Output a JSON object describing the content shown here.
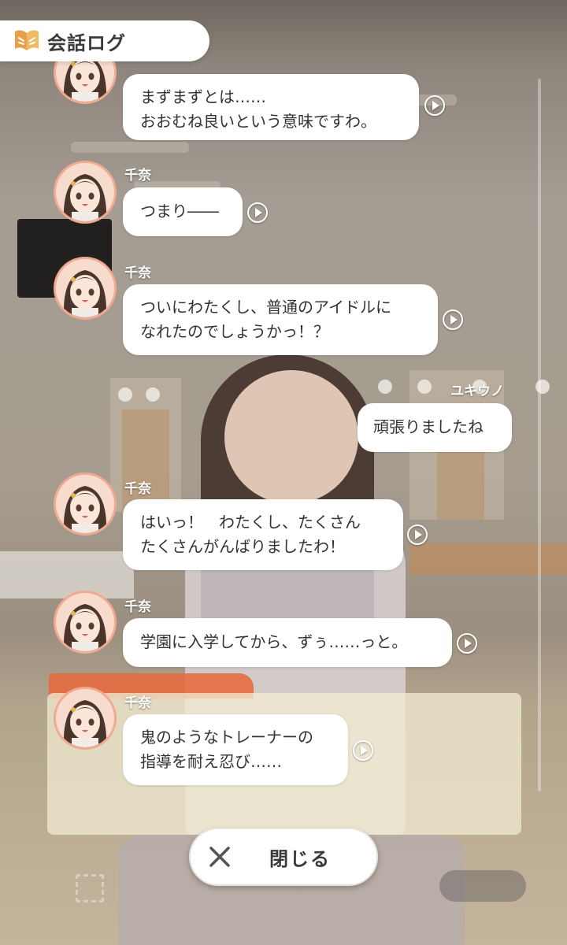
{
  "header": {
    "title": "会話ログ",
    "icon": "book-leaf-icon"
  },
  "log": {
    "entries": [
      {
        "speaker": "",
        "side": "left",
        "text": "まずまずとは……\nおおむね良いという意味ですわ。",
        "voice": true
      },
      {
        "speaker": "千奈",
        "side": "left",
        "text": "つまり――",
        "voice": true
      },
      {
        "speaker": "千奈",
        "side": "left",
        "text": "ついにわたくし、普通のアイドルに\nなれたのでしょうかっ！？",
        "voice": true
      },
      {
        "speaker": "ユキウノ",
        "side": "right",
        "text": "頑張りましたね",
        "voice": false
      },
      {
        "speaker": "千奈",
        "side": "left",
        "text": "はいっ！　わたくし、たくさん\nたくさんがんばりましたわ！",
        "voice": true
      },
      {
        "speaker": "千奈",
        "side": "left",
        "text": "学園に入学してから、ずぅ……っと。",
        "voice": true
      },
      {
        "speaker": "千奈",
        "side": "left",
        "text": "鬼のようなトレーナーの\n指導を耐え忍び……",
        "voice": true
      }
    ]
  },
  "close_button": {
    "label": "閉じる",
    "icon": "close-x-icon"
  },
  "colors": {
    "avatar_border": "#f2a992",
    "bubble": "#ffffff",
    "header_icon": "#e9a04a"
  }
}
